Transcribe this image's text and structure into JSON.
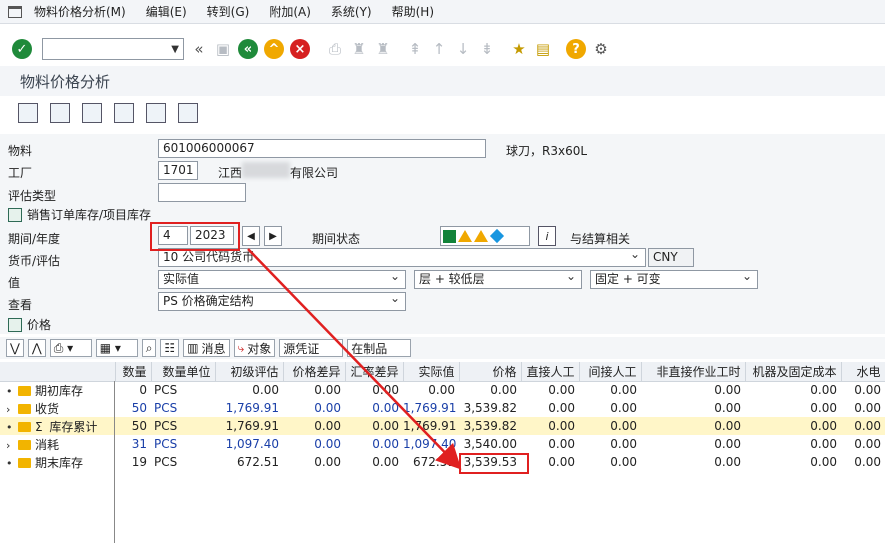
{
  "menu": [
    "物料价格分析(M)",
    "编辑(E)",
    "转到(G)",
    "附加(A)",
    "系统(Y)",
    "帮助(H)"
  ],
  "title": "物料价格分析",
  "form": {
    "material_label": "物料",
    "material_value": "601006000067",
    "material_desc": "球刀，R3x60L",
    "plant_label": "工厂",
    "plant_value": "1701",
    "plant_desc_prefix": "江西",
    "plant_desc_suffix": "有限公司",
    "valtype_label": "评估类型",
    "sales_stock_label": "销售订单库存/项目库存",
    "period_label": "期间/年度",
    "period_value": "4",
    "year_value": "2023",
    "period_status_label": "期间状态",
    "settlement_label": "与结算相关",
    "currency_label": "货币/评估",
    "currency_value": "10 公司代码货币",
    "currency_code": "CNY",
    "value_label": "值",
    "value_select": "实际值",
    "level_select": "层 + 较低层",
    "fixed_select": "固定 + 可变",
    "view_label": "查看",
    "view_select": "PS 价格确定结构",
    "price_label": "价格"
  },
  "gridbar": {
    "msg_label": "消息",
    "obj_label": "对象",
    "source_label": "源凭证",
    "wip_label": "在制品"
  },
  "columns": [
    "数量",
    "数量单位",
    "初级评估",
    "价格差异",
    "汇率差异",
    "实际值",
    "价格",
    "直接人工",
    "间接人工",
    "非直接作业工时",
    "机器及固定成本",
    "水电"
  ],
  "rows": [
    {
      "label": "期初库存",
      "expander": "•",
      "cells": [
        "0",
        "PCS",
        "0.00",
        "0.00",
        "0.00",
        "0.00",
        "0.00",
        "0.00",
        "0.00",
        "0.00",
        "0.00",
        "0.00"
      ],
      "blue": false,
      "hl": false,
      "sum": false
    },
    {
      "label": "收货",
      "expander": "›",
      "cells": [
        "50",
        "PCS",
        "1,769.91",
        "0.00",
        "0.00",
        "1,769.91",
        "3,539.82",
        "0.00",
        "0.00",
        "0.00",
        "0.00",
        "0.00"
      ],
      "blue": true,
      "hl": false,
      "sum": false
    },
    {
      "label": "库存累计",
      "expander": "•",
      "cells": [
        "50",
        "PCS",
        "1,769.91",
        "0.00",
        "0.00",
        "1,769.91",
        "3,539.82",
        "0.00",
        "0.00",
        "0.00",
        "0.00",
        "0.00"
      ],
      "blue": false,
      "hl": true,
      "sum": true
    },
    {
      "label": "消耗",
      "expander": "›",
      "cells": [
        "31",
        "PCS",
        "1,097.40",
        "0.00",
        "0.00",
        "1,097.40",
        "3,540.00",
        "0.00",
        "0.00",
        "0.00",
        "0.00",
        "0.00"
      ],
      "blue": true,
      "hl": false,
      "sum": false
    },
    {
      "label": "期末库存",
      "expander": "•",
      "cells": [
        "19",
        "PCS",
        "672.51",
        "0.00",
        "0.00",
        "672.51",
        "3,539.53",
        "0.00",
        "0.00",
        "0.00",
        "0.00",
        "0.00"
      ],
      "blue": false,
      "hl": false,
      "sum": false
    }
  ],
  "colors": {
    "accent_red": "#e02020",
    "blue_text": "#1a3fa8",
    "highlight": "#fff6c8",
    "folder": "#f2b400"
  }
}
